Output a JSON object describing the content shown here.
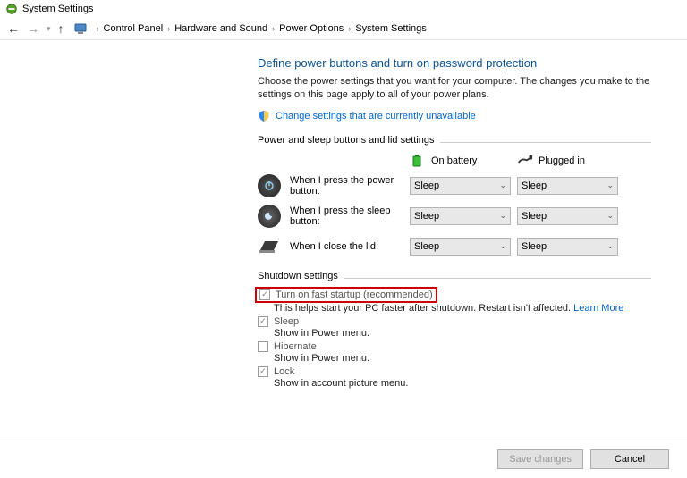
{
  "titlebar": {
    "text": "System Settings"
  },
  "breadcrumb": {
    "items": [
      "Control Panel",
      "Hardware and Sound",
      "Power Options",
      "System Settings"
    ]
  },
  "heading": "Define power buttons and turn on password protection",
  "description": "Choose the power settings that you want for your computer. The changes you make to the settings on this page apply to all of your power plans.",
  "change_link": "Change settings that are currently unavailable",
  "section1": {
    "title": "Power and sleep buttons and lid settings",
    "col_battery": "On battery",
    "col_plugged": "Plugged in",
    "rows": [
      {
        "label": "When I press the power button:",
        "battery": "Sleep",
        "plugged": "Sleep"
      },
      {
        "label": "When I press the sleep button:",
        "battery": "Sleep",
        "plugged": "Sleep"
      },
      {
        "label": "When I close the lid:",
        "battery": "Sleep",
        "plugged": "Sleep"
      }
    ]
  },
  "section2": {
    "title": "Shutdown settings",
    "opt_fast": "Turn on fast startup (recommended)",
    "opt_fast_sub": "This helps start your PC faster after shutdown. Restart isn't affected. ",
    "learn_more": "Learn More",
    "opt_sleep": "Sleep",
    "opt_sleep_sub": "Show in Power menu.",
    "opt_hibernate": "Hibernate",
    "opt_hibernate_sub": "Show in Power menu.",
    "opt_lock": "Lock",
    "opt_lock_sub": "Show in account picture menu."
  },
  "footer": {
    "save": "Save changes",
    "cancel": "Cancel"
  }
}
